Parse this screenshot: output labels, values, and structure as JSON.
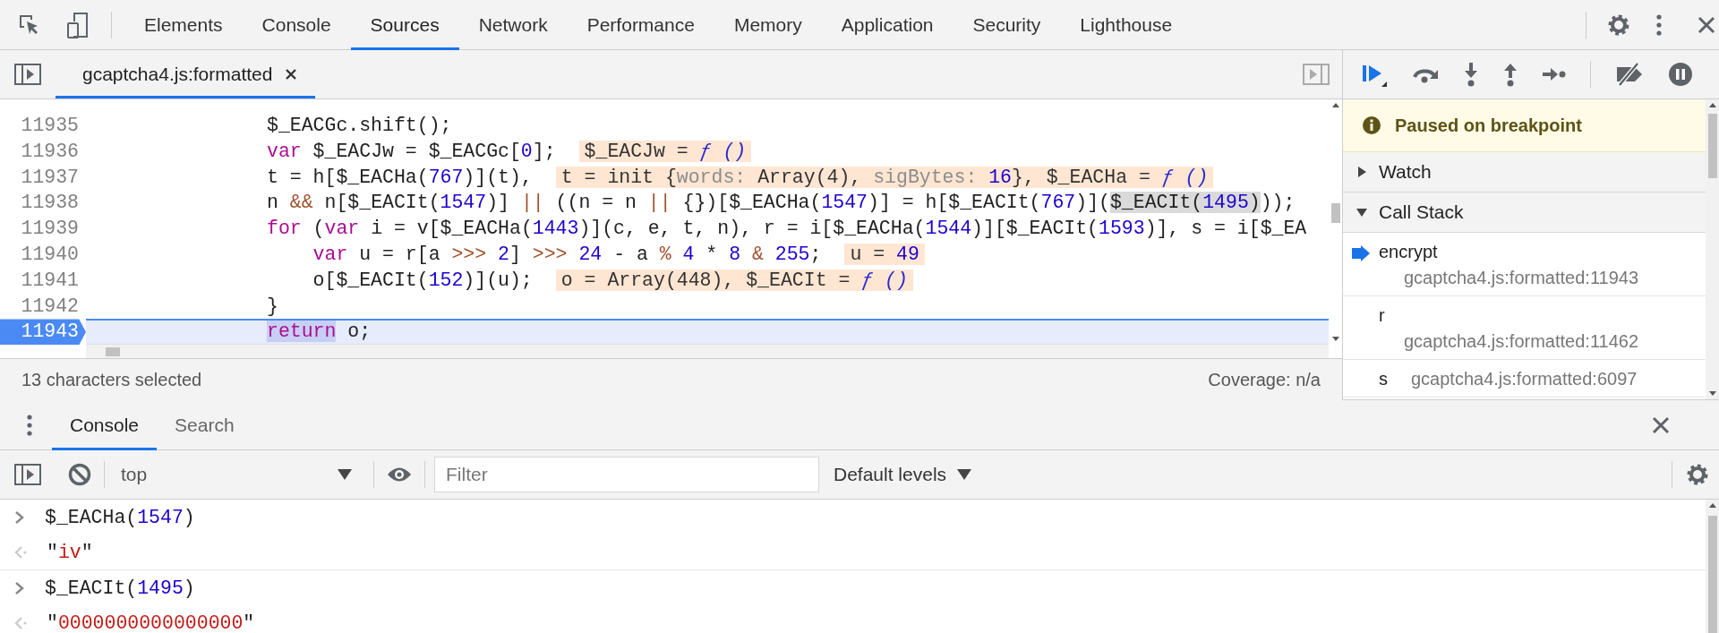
{
  "toolbar_tabs": [
    {
      "label": "Elements",
      "selected": false
    },
    {
      "label": "Console",
      "selected": false
    },
    {
      "label": "Sources",
      "selected": true
    },
    {
      "label": "Network",
      "selected": false
    },
    {
      "label": "Performance",
      "selected": false
    },
    {
      "label": "Memory",
      "selected": false
    },
    {
      "label": "Application",
      "selected": false
    },
    {
      "label": "Security",
      "selected": false
    },
    {
      "label": "Lighthouse",
      "selected": false
    }
  ],
  "file_tab": {
    "title": "gcaptcha4.js:formatted"
  },
  "code_lines": [
    {
      "number": "11935",
      "current": false,
      "segments": [
        {
          "kind": "text",
          "tokens": [
            {
              "kind": "plain",
              "text": "$_EACGc.shift();"
            }
          ]
        }
      ]
    },
    {
      "number": "11936",
      "current": false,
      "segments": [
        {
          "kind": "text",
          "tokens": [
            {
              "kind": "keyword",
              "text": "var"
            },
            {
              "kind": "plain",
              "text": " $_EACJw = $_EACGc["
            },
            {
              "kind": "number",
              "text": "0"
            },
            {
              "kind": "plain",
              "text": "];"
            }
          ]
        }
      ],
      "inline_value": [
        {
          "kind": "plain",
          "text": "$_EACJw = "
        },
        {
          "kind": "fn",
          "text": "ƒ ()"
        }
      ]
    },
    {
      "number": "11937",
      "current": false,
      "segments": [
        {
          "kind": "text",
          "tokens": [
            {
              "kind": "plain",
              "text": "t = h[$_EACHa("
            },
            {
              "kind": "number",
              "text": "767"
            },
            {
              "kind": "plain",
              "text": ")](t),"
            }
          ]
        }
      ],
      "inline_value": [
        {
          "kind": "plain",
          "text": "t = init {"
        },
        {
          "kind": "prop",
          "text": "words: "
        },
        {
          "kind": "plain",
          "text": "Array(4), "
        },
        {
          "kind": "prop",
          "text": "sigBytes: "
        },
        {
          "kind": "number",
          "text": "16"
        },
        {
          "kind": "plain",
          "text": "}, $_EACHa = "
        },
        {
          "kind": "fn",
          "text": "ƒ ()"
        }
      ]
    },
    {
      "number": "11938",
      "current": false,
      "segments": [
        {
          "kind": "text",
          "tokens": [
            {
              "kind": "plain",
              "text": "n "
            },
            {
              "kind": "operator",
              "text": "&&"
            },
            {
              "kind": "plain",
              "text": " n[$_EACIt("
            },
            {
              "kind": "number",
              "text": "1547"
            },
            {
              "kind": "plain",
              "text": ")] "
            },
            {
              "kind": "operator",
              "text": "||"
            },
            {
              "kind": "plain",
              "text": " ((n = n "
            },
            {
              "kind": "operator",
              "text": "||"
            },
            {
              "kind": "plain",
              "text": " {})[$_EACHa("
            },
            {
              "kind": "number",
              "text": "1547"
            },
            {
              "kind": "plain",
              "text": ")] = h[$_EACIt("
            },
            {
              "kind": "number",
              "text": "767"
            },
            {
              "kind": "plain",
              "text": ")]("
            }
          ]
        },
        {
          "kind": "selection",
          "tokens": [
            {
              "kind": "plain",
              "text": "$_EACIt("
            },
            {
              "kind": "number",
              "text": "1495"
            },
            {
              "kind": "plain",
              "text": ")"
            }
          ]
        },
        {
          "kind": "text",
          "tokens": [
            {
              "kind": "plain",
              "text": "));"
            }
          ]
        }
      ]
    },
    {
      "number": "11939",
      "current": false,
      "segments": [
        {
          "kind": "text",
          "tokens": [
            {
              "kind": "keyword",
              "text": "for"
            },
            {
              "kind": "plain",
              "text": " ("
            },
            {
              "kind": "keyword",
              "text": "var"
            },
            {
              "kind": "plain",
              "text": " i = v[$_EACHa("
            },
            {
              "kind": "number",
              "text": "1443"
            },
            {
              "kind": "plain",
              "text": ")](c, e, t, n), r = i[$_EACHa("
            },
            {
              "kind": "number",
              "text": "1544"
            },
            {
              "kind": "plain",
              "text": ")][$_EACIt("
            },
            {
              "kind": "number",
              "text": "1593"
            },
            {
              "kind": "plain",
              "text": ")], s = i[$_EA"
            }
          ]
        }
      ]
    },
    {
      "number": "11940",
      "current": false,
      "segments": [
        {
          "kind": "text",
          "tokens": [
            {
              "kind": "keyword",
              "text": "    var"
            },
            {
              "kind": "plain",
              "text": " u = r[a "
            },
            {
              "kind": "operator",
              "text": ">>>"
            },
            {
              "kind": "number",
              "text": " 2"
            },
            {
              "kind": "plain",
              "text": "] "
            },
            {
              "kind": "operator",
              "text": ">>>"
            },
            {
              "kind": "number",
              "text": " 24"
            },
            {
              "kind": "plain",
              "text": " - a "
            },
            {
              "kind": "operator",
              "text": "%"
            },
            {
              "kind": "number",
              "text": " 4"
            },
            {
              "kind": "plain",
              "text": " * "
            },
            {
              "kind": "number",
              "text": "8"
            },
            {
              "kind": "operator",
              "text": " &"
            },
            {
              "kind": "number",
              "text": " 255"
            },
            {
              "kind": "plain",
              "text": ";"
            }
          ]
        }
      ],
      "inline_value": [
        {
          "kind": "plain",
          "text": "u = "
        },
        {
          "kind": "number",
          "text": "49"
        }
      ]
    },
    {
      "number": "11941",
      "current": false,
      "segments": [
        {
          "kind": "text",
          "tokens": [
            {
              "kind": "plain",
              "text": "    o[$_EACIt("
            },
            {
              "kind": "number",
              "text": "152"
            },
            {
              "kind": "plain",
              "text": ")](u);"
            }
          ]
        }
      ],
      "inline_value": [
        {
          "kind": "plain",
          "text": "o = Array(448), $_EACIt = "
        },
        {
          "kind": "fn",
          "text": "ƒ ()"
        }
      ]
    },
    {
      "number": "11942",
      "current": false,
      "segments": [
        {
          "kind": "text",
          "tokens": [
            {
              "kind": "plain",
              "text": "}"
            }
          ]
        }
      ]
    },
    {
      "number": "11943",
      "current": true,
      "segments": [
        {
          "kind": "execution",
          "tokens": [
            {
              "kind": "keyword",
              "text": "return"
            }
          ]
        },
        {
          "kind": "text",
          "tokens": [
            {
              "kind": "plain",
              "text": " o;"
            }
          ]
        }
      ]
    }
  ],
  "status_bar": {
    "selection": "13 characters selected",
    "coverage": "Coverage: n/a"
  },
  "debugger": {
    "banner": "Paused on breakpoint",
    "sections": [
      {
        "title": "Watch",
        "expanded": false
      },
      {
        "title": "Call Stack",
        "expanded": true,
        "frames": [
          {
            "name": "encrypt",
            "location": "gcaptcha4.js:formatted:11943",
            "selected": true,
            "kind": "wrapped"
          },
          {
            "name": "r",
            "location": "gcaptcha4.js:formatted:11462",
            "selected": false,
            "kind": "wrapped"
          },
          {
            "name": "s",
            "location": "gcaptcha4.js:formatted:6097",
            "selected": false,
            "kind": "inline"
          }
        ]
      }
    ]
  },
  "drawer_tabs": [
    {
      "label": "Console",
      "selected": true
    },
    {
      "label": "Search",
      "selected": false
    }
  ],
  "console_toolbar": {
    "context": "top",
    "filter_placeholder": "Filter",
    "levels": "Default levels"
  },
  "console_messages": [
    {
      "kind": "input",
      "tokens": [
        {
          "kind": "plain",
          "text": "$_EACHa("
        },
        {
          "kind": "number",
          "text": "1547"
        },
        {
          "kind": "plain",
          "text": ")"
        }
      ]
    },
    {
      "kind": "output",
      "tokens": [
        {
          "kind": "plain",
          "text": "\""
        },
        {
          "kind": "string",
          "text": "iv"
        },
        {
          "kind": "plain",
          "text": "\""
        }
      ]
    },
    {
      "kind": "input",
      "tokens": [
        {
          "kind": "plain",
          "text": "$_EACIt("
        },
        {
          "kind": "number",
          "text": "1495"
        },
        {
          "kind": "plain",
          "text": ")"
        }
      ]
    },
    {
      "kind": "output",
      "tokens": [
        {
          "kind": "plain",
          "text": "\""
        },
        {
          "kind": "string",
          "text": "0000000000000000"
        },
        {
          "kind": "plain",
          "text": "\""
        }
      ]
    }
  ]
}
